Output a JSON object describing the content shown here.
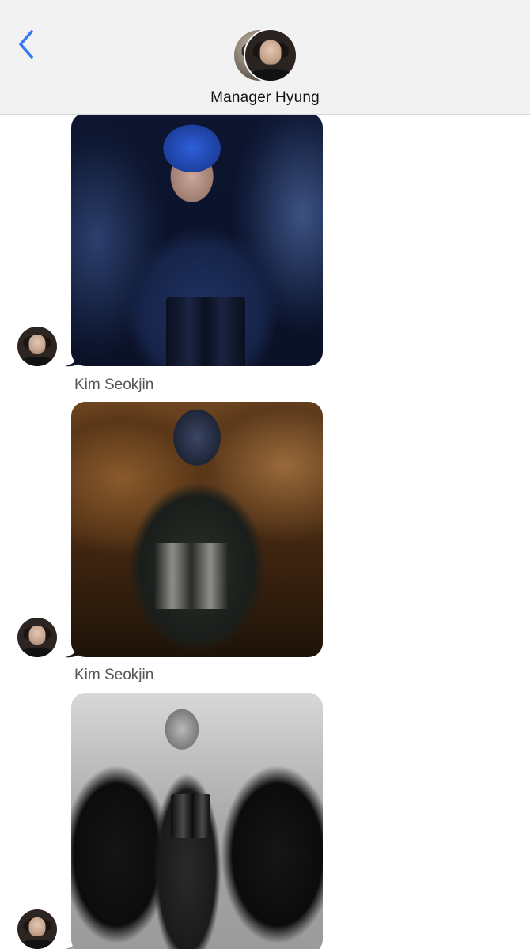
{
  "header": {
    "title": "Manager Hyung",
    "back_icon": "chevron-left-icon",
    "accent_color": "#3478F6",
    "background": "#F2F2F3"
  },
  "messages": [
    {
      "sender": "Kim Seokjin",
      "type": "photo"
    },
    {
      "sender": "Kim Seokjin",
      "type": "photo"
    },
    {
      "sender": "",
      "type": "photo"
    }
  ]
}
